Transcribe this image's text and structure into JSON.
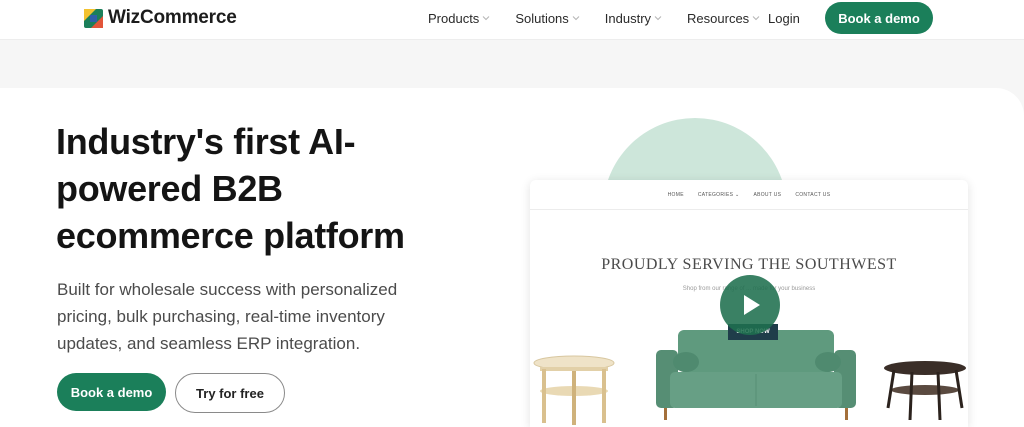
{
  "header": {
    "brand": "WizCommerce",
    "nav": [
      {
        "label": "Products"
      },
      {
        "label": "Solutions"
      },
      {
        "label": "Industry"
      },
      {
        "label": "Resources"
      }
    ],
    "login_label": "Login",
    "cta_label": "Book a demo"
  },
  "hero": {
    "headline": "Industry's first AI-powered B2B ecommerce platform",
    "subtext": "Built for wholesale success with personalized pricing, bulk purchasing, real-time inventory updates, and seamless ERP integration.",
    "primary_cta": "Book a demo",
    "secondary_cta": "Try for free"
  },
  "mock_site": {
    "nav": [
      "HOME",
      "CATEGORIES",
      "ABOUT US",
      "CONTACT US"
    ],
    "title": "PROUDLY SERVING THE SOUTHWEST",
    "subtitle": "Shop from our range of ... made for your business",
    "shop_button": "SHOP NOW"
  },
  "colors": {
    "brand_green": "#1b7f5a",
    "sofa_green": "#5f9a7e",
    "arc_mint": "#cde6da"
  },
  "icons": [
    "logo-mark-icon",
    "chevron-down-icon",
    "play-icon"
  ]
}
